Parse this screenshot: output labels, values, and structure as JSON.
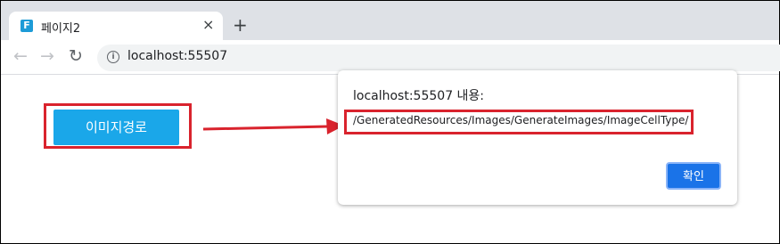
{
  "browser": {
    "tab_title": "페이지2",
    "favicon_letter": "F",
    "tab_close": "×",
    "new_tab": "+",
    "url": "localhost:55507"
  },
  "page": {
    "image_button_label": "이미지경로"
  },
  "dialog": {
    "title": "localhost:55507 내용:",
    "message": "/GeneratedResources/Images/GenerateImages/ImageCellType/",
    "ok_label": "확인"
  },
  "colors": {
    "highlight": "#d9232d",
    "button": "#1aa7e9",
    "ok_button": "#1a73e8"
  }
}
